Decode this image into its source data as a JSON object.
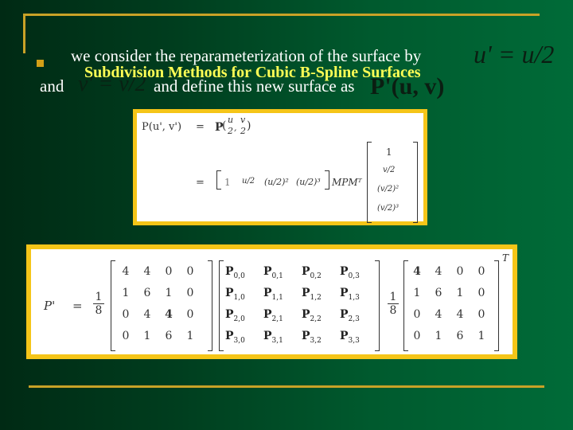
{
  "slide": {
    "title": "Subdivision Methods for Cubic B-Spline Surfaces",
    "bullet_text": "we consider the reparameterization of the surface by",
    "math_u": "u' = u/2",
    "line2_prefix": "and",
    "math_v": "v' = v/2",
    "line2_mid": "and define this new surface as",
    "math_P": "P'(u, v)",
    "colors": {
      "accent": "#c9a227",
      "title": "#ffff55",
      "box_border": "#f5c518",
      "bg_dark": "#002a14",
      "bg_light": "#006b38"
    }
  },
  "equation1": {
    "lhs": "P(u', v')",
    "eq": "=",
    "rhs1_P": "P",
    "rhs1_args": [
      "u/2",
      "v/2"
    ],
    "row_vector": [
      "1",
      "u/2",
      "(u/2)²",
      "(u/2)³"
    ],
    "middle": "MPMᵀ",
    "col_vector": [
      "1",
      "v/2",
      "(v/2)²",
      "(v/2)³"
    ]
  },
  "equation2": {
    "lhs": "P'",
    "eq": "=",
    "scale": "1/8",
    "left_matrix": [
      [
        "4",
        "4",
        "0",
        "0"
      ],
      [
        "1",
        "6",
        "1",
        "0"
      ],
      [
        "0",
        "4",
        "4",
        "0"
      ],
      [
        "0",
        "1",
        "6",
        "1"
      ]
    ],
    "control_points": [
      [
        "P0,0",
        "P0,1",
        "P0,2",
        "P0,3"
      ],
      [
        "P1,0",
        "P1,1",
        "P1,2",
        "P1,3"
      ],
      [
        "P2,0",
        "P2,1",
        "P2,2",
        "P2,3"
      ],
      [
        "P3,0",
        "P3,1",
        "P3,2",
        "P3,3"
      ]
    ],
    "right_scale": "1/8",
    "right_matrix": [
      [
        "4",
        "4",
        "0",
        "0"
      ],
      [
        "1",
        "6",
        "1",
        "0"
      ],
      [
        "0",
        "4",
        "4",
        "0"
      ],
      [
        "0",
        "1",
        "6",
        "1"
      ]
    ],
    "transpose": "T"
  }
}
